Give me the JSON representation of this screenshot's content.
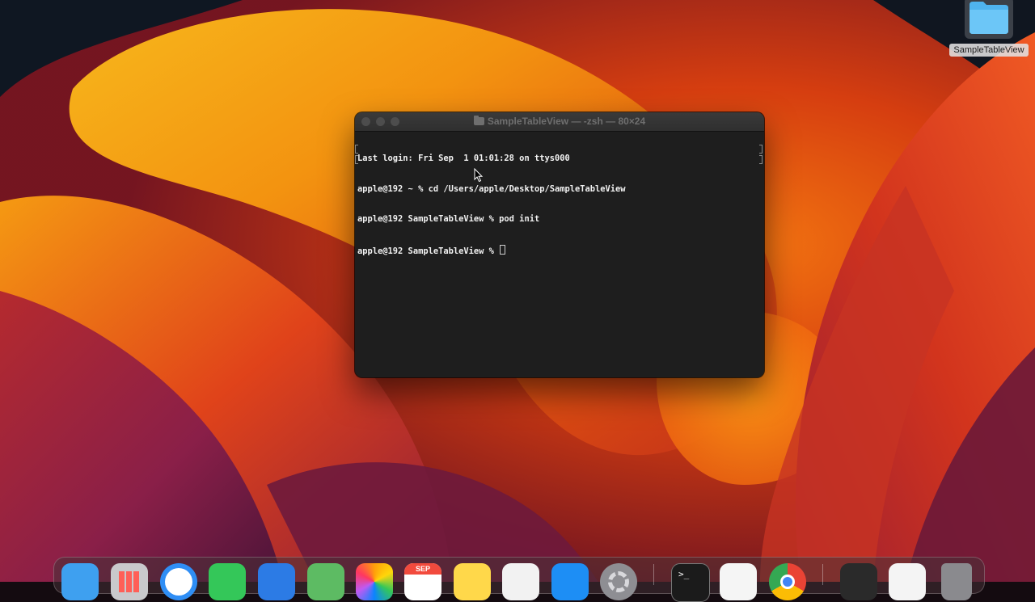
{
  "desktop": {
    "folder_label": "SampleTableView"
  },
  "terminal": {
    "title": "SampleTableView — -zsh — 80×24",
    "lines": [
      "Last login: Fri Sep  1 01:01:28 on ttys000",
      "apple@192 ~ % cd /Users/apple/Desktop/SampleTableView",
      "apple@192 SampleTableView % pod init",
      "apple@192 SampleTableView % "
    ]
  },
  "dock": {
    "apps": [
      {
        "name": "Finder",
        "icon": "finder-icon",
        "color": "#3ea0f0"
      },
      {
        "name": "Launchpad",
        "icon": "launchpad-icon",
        "color": "#c9c9cc"
      },
      {
        "name": "Safari",
        "icon": "safari-icon",
        "color": "#2f8ef5"
      },
      {
        "name": "Messages",
        "icon": "messages-icon",
        "color": "#34c759"
      },
      {
        "name": "Mail",
        "icon": "mail-icon",
        "color": "#2c7be5"
      },
      {
        "name": "Maps",
        "icon": "maps-icon",
        "color": "#5dbb63"
      },
      {
        "name": "Photos",
        "icon": "photos-icon",
        "color": "#ffffff"
      },
      {
        "name": "Calendar",
        "icon": "calendar-icon",
        "color": "#ffffff",
        "month": "SEP"
      },
      {
        "name": "Notes",
        "icon": "notes-icon",
        "color": "#ffd84a"
      },
      {
        "name": "Freeform",
        "icon": "freeform-icon",
        "color": "#f2f2f2"
      },
      {
        "name": "App Store",
        "icon": "app-store-icon",
        "color": "#1d8ef5"
      },
      {
        "name": "System Settings",
        "icon": "gear-icon",
        "color": "#8e8e93"
      },
      {
        "name": "Terminal",
        "icon": "terminal-icon",
        "color": "#1b1b1b",
        "prompt": ">_"
      },
      {
        "name": "TextEdit",
        "icon": "textedit-icon",
        "color": "#f5f5f5"
      },
      {
        "name": "Google Chrome",
        "icon": "chrome-icon",
        "color": "#ffffff"
      },
      {
        "name": "Window Preview 1",
        "icon": "window-thumbnail-icon",
        "color": "#2a2a2a"
      },
      {
        "name": "Window Preview 2",
        "icon": "document-thumbnail-icon",
        "color": "#f4f4f4"
      },
      {
        "name": "Trash",
        "icon": "trash-icon",
        "color": "#8a8a8e"
      }
    ]
  }
}
